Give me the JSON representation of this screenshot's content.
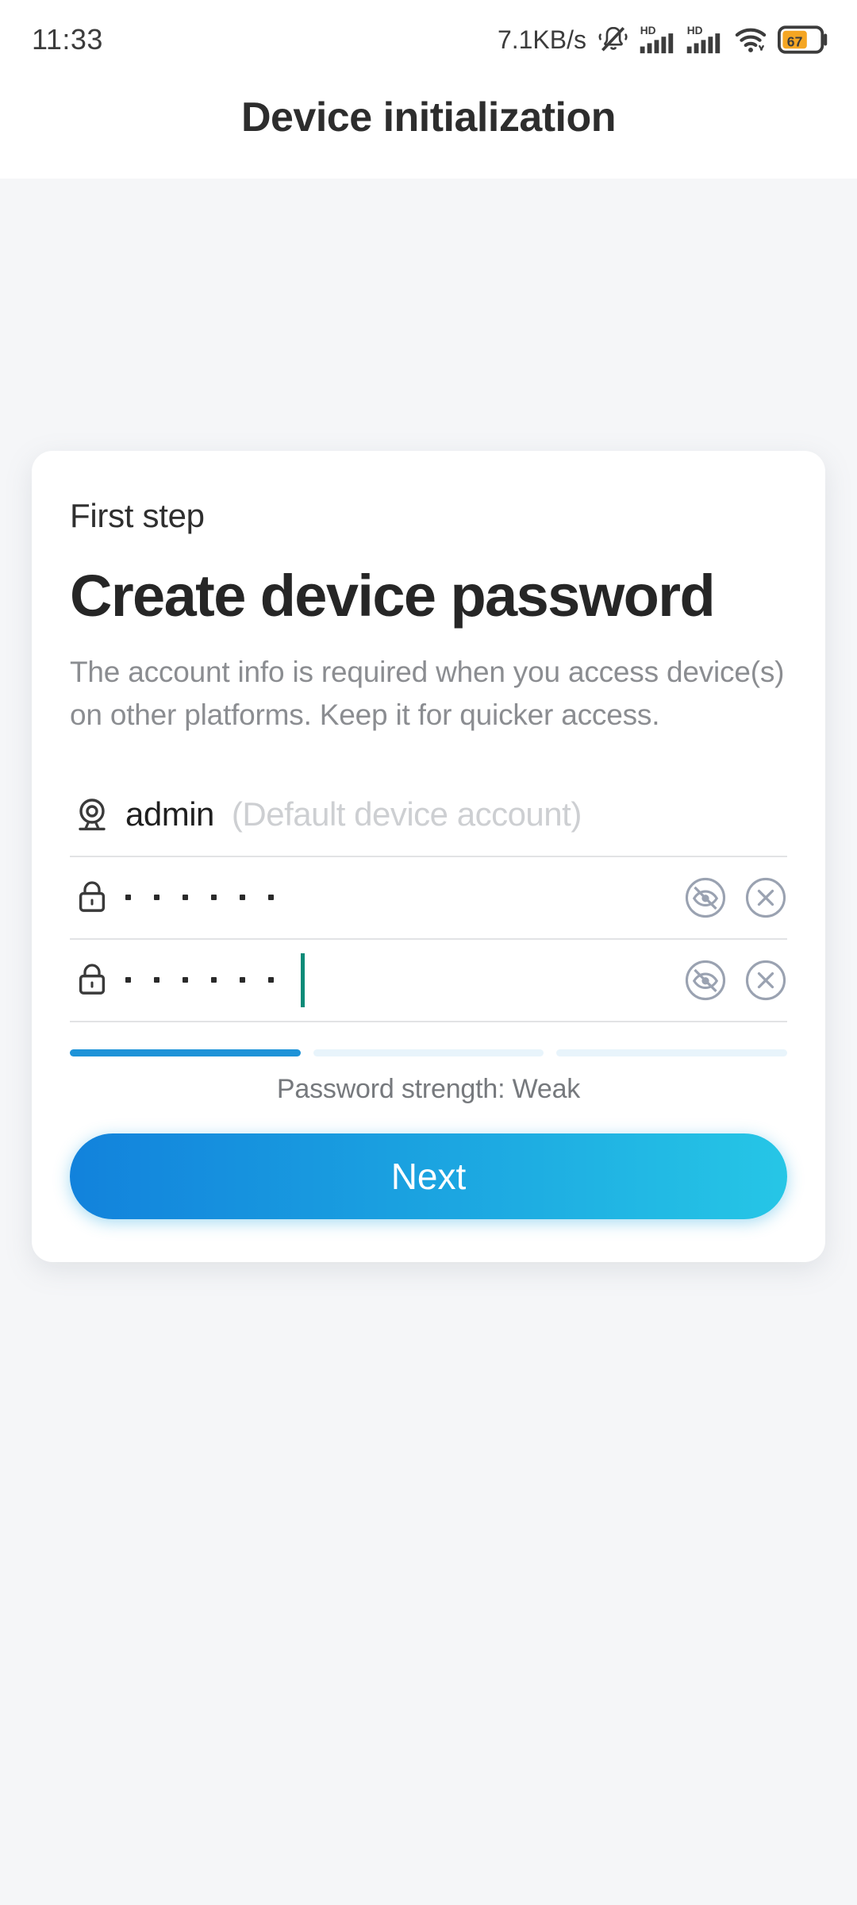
{
  "status_bar": {
    "time": "11:33",
    "network_speed": "7.1KB/s",
    "icons": [
      "bell-muted-icon",
      "signal-hd-1-icon",
      "signal-hd-2-icon",
      "wifi-icon",
      "battery-icon"
    ],
    "battery_percent": "67",
    "battery_color": "#f5a623",
    "signal_label": "HD"
  },
  "header": {
    "title": "Device initialization"
  },
  "card": {
    "step_label": "First step",
    "title": "Create device password",
    "description": "The account info is required when you access device(s) on other platforms. Keep it for quicker access.",
    "account": {
      "icon": "camera-icon",
      "value": "admin",
      "hint": "(Default device account)"
    },
    "password": {
      "icon": "lock-icon",
      "masked_value": "••••••",
      "dot_count": 6,
      "toggle_icon": "eye-off-icon",
      "clear_icon": "clear-circle-icon"
    },
    "confirm_password": {
      "icon": "lock-icon",
      "masked_value": "••••••",
      "dot_count": 6,
      "toggle_icon": "eye-off-icon",
      "clear_icon": "clear-circle-icon",
      "caret_color": "#0c8b78",
      "focused": true
    },
    "strength": {
      "label": "Password strength: Weak",
      "level": 1,
      "total_bars": 3,
      "active_color": "#1e93d8",
      "inactive_color": "#e8f4fb"
    },
    "next_button": {
      "label": "Next",
      "gradient_from": "#1282dc",
      "gradient_to": "#26c6e6"
    }
  }
}
